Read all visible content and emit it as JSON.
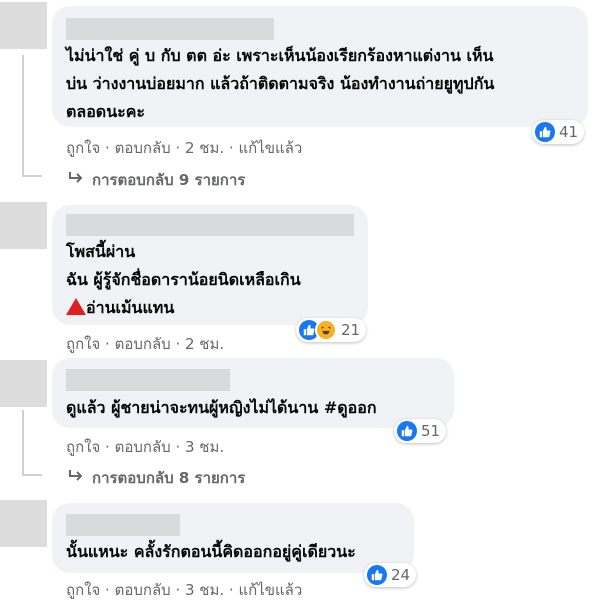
{
  "comments": [
    {
      "lines": [
        "ไม่น่าใช่ คู่ บ กับ ตต อ่ะ เพราะเห็นน้องเรียกร้องหาแต่งาน เห็น",
        "บ่น ว่างงานบ่อยมาก แล้วถ้าติดตามจริง น้องทำงานถ่ายยูทูปกัน",
        "ตลอดนะคะ"
      ],
      "like": "ถูกใจ",
      "reply": "ตอบกลับ",
      "time": "2 ชม.",
      "edited": "แก้ไขแล้ว",
      "reactions": "41",
      "replies_link": "การตอบกลับ 9 รายการ"
    },
    {
      "lines": [
        "โพสนี้ผ่าน",
        "ฉัน ผู้รู้จักชื่อดาราน้อยนิดเหลือเกิน",
        "อ่านเม้นแทน"
      ],
      "like": "ถูกใจ",
      "reply": "ตอบกลับ",
      "time": "2 ชม.",
      "reactions": "21"
    },
    {
      "lines": [
        "ดูแล้ว ผู้ชายน่าจะทนผู้หญิงไม่ได้นาน #ดูออก"
      ],
      "like": "ถูกใจ",
      "reply": "ตอบกลับ",
      "time": "3 ชม.",
      "reactions": "51",
      "replies_link": "การตอบกลับ 8 รายการ"
    },
    {
      "lines": [
        "นั้นแหนะ คลั้งรักตอนนี้คิดออกอยู่คู่เดียวนะ"
      ],
      "like": "ถูกใจ",
      "reply": "ตอบกลับ",
      "time": "3 ชม.",
      "edited": "แก้ไขแล้ว",
      "reactions": "24"
    }
  ],
  "separator": " · ",
  "colors": {
    "like_blue": "#1877f2",
    "haha_yellow": "#f7b125",
    "warning_red": "#e02020",
    "bubble_bg": "#f0f2f5",
    "meta_gray": "#65676b"
  },
  "icons": {
    "like": "thumbs-up-icon",
    "haha": "laughing-face-icon",
    "reply_arrow": "reply-arrow-icon",
    "warning": "red-triangle-icon"
  }
}
